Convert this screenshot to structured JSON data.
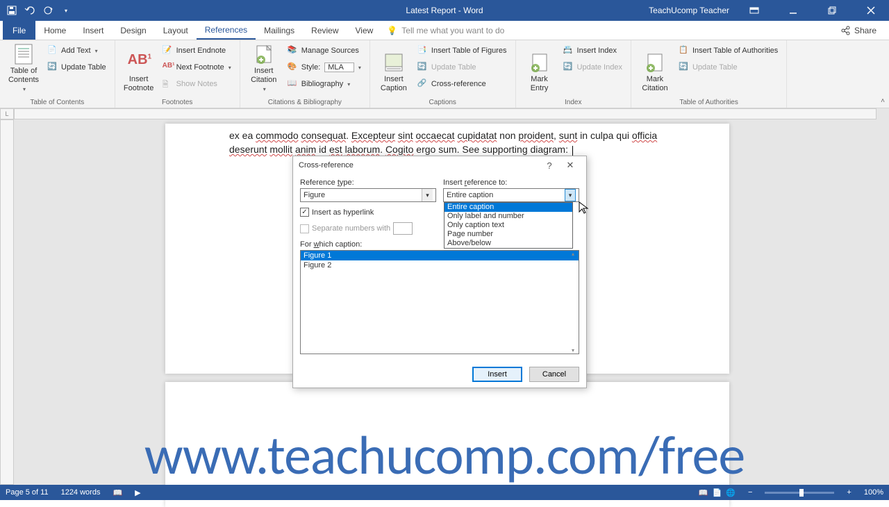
{
  "titlebar": {
    "doc_title": "Latest Report - Word",
    "user": "TeachUcomp Teacher"
  },
  "tabs": {
    "file": "File",
    "home": "Home",
    "insert": "Insert",
    "design": "Design",
    "layout": "Layout",
    "references": "References",
    "mailings": "Mailings",
    "review": "Review",
    "view": "View",
    "tell_me": "Tell me what you want to do",
    "share": "Share"
  },
  "ribbon": {
    "toc": {
      "big": "Table of Contents",
      "add_text": "Add Text",
      "update": "Update Table",
      "group": "Table of Contents"
    },
    "footnotes": {
      "big": "Insert Footnote",
      "endnote": "Insert Endnote",
      "next": "Next Footnote",
      "show": "Show Notes",
      "group": "Footnotes"
    },
    "citations": {
      "big": "Insert Citation",
      "manage": "Manage Sources",
      "style_label": "Style:",
      "style_value": "MLA",
      "bib": "Bibliography",
      "group": "Citations & Bibliography"
    },
    "captions": {
      "big": "Insert Caption",
      "tof": "Insert Table of Figures",
      "update": "Update Table",
      "cross": "Cross-reference",
      "group": "Captions"
    },
    "index": {
      "big": "Mark Entry",
      "insert": "Insert Index",
      "update": "Update Index",
      "group": "Index"
    },
    "toa": {
      "big": "Mark Citation",
      "insert": "Insert Table of Authorities",
      "update": "Update Table",
      "group": "Table of Authorities"
    }
  },
  "document": {
    "line1_a": "ex ea ",
    "line1_b": "commodo",
    "line1_c": " ",
    "line1_d": "consequat",
    "line1_e": ". ",
    "line1_f": "Excepteur",
    "line1_g": " ",
    "line1_h": "sint",
    "line1_i": " ",
    "line1_j": "occaecat",
    "line1_k": " ",
    "line1_l": "cupidatat",
    "line1_m": " non ",
    "line1_n": "proident",
    "line1_o": ", ",
    "line1_p": "sunt",
    "line1_q": " in culpa qui ",
    "line1_r": "officia",
    "line2_a": "deserunt",
    "line2_b": " ",
    "line2_c": "mollit",
    "line2_d": " ",
    "line2_e": "anim",
    "line2_f": " id ",
    "line2_g": "est",
    "line2_h": " ",
    "line2_i": "laborum",
    "line2_j": ". ",
    "line2_k": "Cogito",
    "line2_l": " ergo sum. See supporting diagram: "
  },
  "dialog": {
    "title": "Cross-reference",
    "ref_type_label": "Reference type:",
    "ref_type_value": "Figure",
    "insert_ref_to_label": "Insert reference to:",
    "insert_ref_to_value": "Entire caption",
    "insert_hyperlink": "Insert as hyperlink",
    "separate_numbers": "Separate numbers with",
    "for_which": "For which caption:",
    "captions": {
      "0": "Figure 1",
      "1": "Figure 2"
    },
    "dd_options": {
      "0": "Entire caption",
      "1": "Only label and number",
      "2": "Only caption text",
      "3": "Page number",
      "4": "Above/below"
    },
    "insert_btn": "Insert",
    "cancel_btn": "Cancel"
  },
  "watermark": "www.teachucomp.com/free",
  "statusbar": {
    "page": "Page 5 of 11",
    "words": "1224 words",
    "zoom": "100%"
  }
}
